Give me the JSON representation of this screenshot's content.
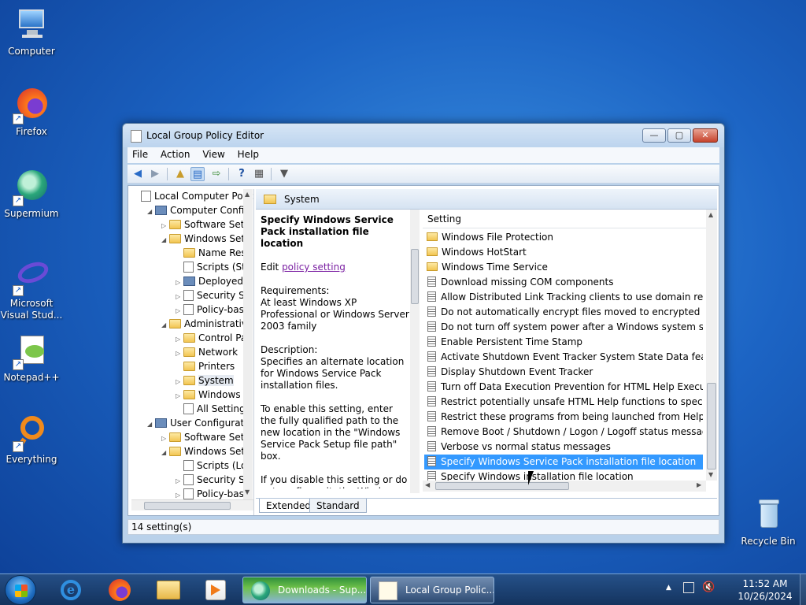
{
  "desktop": {
    "icons": [
      {
        "label": "Computer"
      },
      {
        "label": "Firefox"
      },
      {
        "label": "Supermium"
      },
      {
        "label": "Microsoft Visual Stud..."
      },
      {
        "label": "Notepad++"
      },
      {
        "label": "Everything"
      },
      {
        "label": "Recycle Bin"
      }
    ]
  },
  "window": {
    "title": "Local Group Policy Editor",
    "controls": {
      "minimize": "—",
      "maximize": "▢",
      "close": "✕"
    },
    "menu": [
      "File",
      "Action",
      "View",
      "Help"
    ],
    "toolbar": [
      "back-icon",
      "forward-icon",
      "up-folder-icon",
      "show-hide-tree-icon",
      "export-list-icon",
      "help-icon",
      "properties-icon",
      "filter-icon"
    ],
    "tree": [
      {
        "label": "Local Computer Polic",
        "icon": "doc",
        "expander": ""
      },
      {
        "label": "Computer Config",
        "icon": "pc",
        "expander": "◢"
      },
      {
        "label": "Software Setti",
        "icon": "folder",
        "expander": "▷"
      },
      {
        "label": "Windows Sett",
        "icon": "folder",
        "expander": "◢"
      },
      {
        "label": "Name Res",
        "icon": "folder",
        "expander": ""
      },
      {
        "label": "Scripts (Sta",
        "icon": "doc",
        "expander": ""
      },
      {
        "label": "Deployed",
        "icon": "pc",
        "expander": "▷"
      },
      {
        "label": "Security S",
        "icon": "doc",
        "expander": "▷"
      },
      {
        "label": "Policy-bas",
        "icon": "chart",
        "expander": "▷"
      },
      {
        "label": "Administrativ",
        "icon": "folder",
        "expander": "◢"
      },
      {
        "label": "Control Pa",
        "icon": "folder",
        "expander": "▷"
      },
      {
        "label": "Network",
        "icon": "folder",
        "expander": "▷"
      },
      {
        "label": "Printers",
        "icon": "folder",
        "expander": ""
      },
      {
        "label": "System",
        "icon": "folder",
        "expander": "▷"
      },
      {
        "label": "Windows C",
        "icon": "folder",
        "expander": "▷"
      },
      {
        "label": "All Setting",
        "icon": "doc",
        "expander": ""
      },
      {
        "label": "User Configuration",
        "icon": "pc",
        "expander": "◢"
      },
      {
        "label": "Software Setti",
        "icon": "folder",
        "expander": "▷"
      },
      {
        "label": "Windows Sett",
        "icon": "folder",
        "expander": "◢"
      },
      {
        "label": "Scripts (Lo",
        "icon": "doc",
        "expander": ""
      },
      {
        "label": "Security Se",
        "icon": "doc",
        "expander": "▷"
      },
      {
        "label": "Policy-bas",
        "icon": "chart",
        "expander": "▷"
      }
    ],
    "pane": {
      "header": "System",
      "description": {
        "title": "Specify Windows Service Pack installation file location",
        "edit_prefix": "Edit ",
        "edit_link": "policy setting",
        "requirements_label": "Requirements:",
        "requirements": "At least Windows XP Professional or Windows Server 2003 family",
        "description_label": "Description:",
        "description": "Specifies an alternate location for Windows Service Pack installation files.",
        "enable_text": "To enable this setting, enter the fully qualified path to the new location in the \"Windows Service Pack Setup file path\" box.",
        "disable_text": "If you disable this setting or do not configure it, the Windows Service Pack Setup source path will be the location used during the last time Windows Service"
      },
      "list_header": "Setting",
      "rows": [
        {
          "label": "Windows File Protection",
          "type": "folder"
        },
        {
          "label": "Windows HotStart",
          "type": "folder"
        },
        {
          "label": "Windows Time Service",
          "type": "folder"
        },
        {
          "label": "Download missing COM components",
          "type": "setting"
        },
        {
          "label": "Allow Distributed Link Tracking clients to use domain resour...",
          "type": "setting"
        },
        {
          "label": "Do not automatically encrypt files moved to encrypted fold...",
          "type": "setting"
        },
        {
          "label": "Do not turn off system power after a Windows system shutd...",
          "type": "setting"
        },
        {
          "label": "Enable Persistent Time Stamp",
          "type": "setting"
        },
        {
          "label": "Activate Shutdown Event Tracker System State Data feature",
          "type": "setting"
        },
        {
          "label": "Display Shutdown Event Tracker",
          "type": "setting"
        },
        {
          "label": "Turn off Data Execution Prevention for HTML Help Executible",
          "type": "setting"
        },
        {
          "label": "Restrict potentially unsafe HTML Help functions to specified...",
          "type": "setting"
        },
        {
          "label": "Restrict these programs from being launched from Help",
          "type": "setting"
        },
        {
          "label": "Remove Boot / Shutdown / Logon / Logoff status messages",
          "type": "setting"
        },
        {
          "label": "Verbose vs normal status messages",
          "type": "setting"
        },
        {
          "label": "Specify Windows Service Pack installation file location",
          "type": "setting",
          "selected": true
        },
        {
          "label": "Specify Windows installation file location",
          "type": "setting"
        }
      ],
      "tabs": [
        "Extended",
        "Standard"
      ]
    },
    "status": "14 setting(s)"
  },
  "taskbar": {
    "tasks": [
      {
        "label": "Downloads - Sup..."
      },
      {
        "label": "Local Group Polic..."
      }
    ],
    "clock": {
      "time": "11:52 AM",
      "date": "10/26/2024"
    }
  }
}
